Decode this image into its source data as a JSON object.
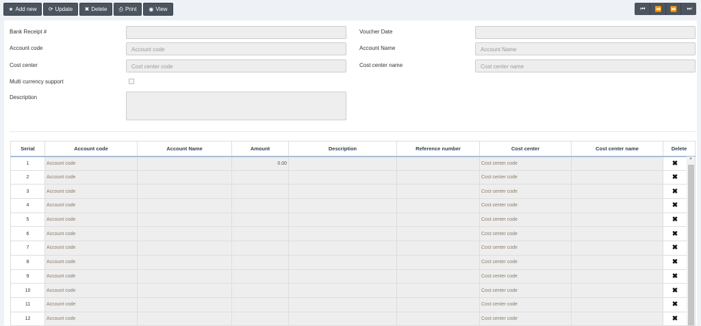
{
  "toolbar": {
    "add_new": "Add new",
    "update": "Update",
    "delete": "Delete",
    "print": "Print",
    "view": "View",
    "nav": [
      "⏮",
      "⏪",
      "⏩",
      "⏭"
    ]
  },
  "form": {
    "bank_receipt_label": "Bank Receipt #",
    "voucher_date_label": "Voucher Date",
    "account_code_label": "Account code",
    "account_code_placeholder": "Account code",
    "account_name_label": "Account Name",
    "account_name_placeholder": "Account Name",
    "cost_center_label": "Cost center",
    "cost_center_placeholder": "Cost center code",
    "cost_center_name_label": "Cost center name",
    "cost_center_name_placeholder": "Cost center name",
    "multi_currency_label": "Multi currency support",
    "description_label": "Description"
  },
  "table": {
    "headers": [
      "Serial",
      "Account code",
      "Account Name",
      "Amount",
      "Description",
      "Reference number",
      "Cost center",
      "Cost center name",
      "Delete"
    ],
    "rows": [
      {
        "serial": "1",
        "account_code": "Account code",
        "amount": "0.00",
        "cost_center": "Cost center code"
      },
      {
        "serial": "2",
        "account_code": "Account code",
        "amount": "",
        "cost_center": "Cost center code"
      },
      {
        "serial": "3",
        "account_code": "Account code",
        "amount": "",
        "cost_center": "Cost center code"
      },
      {
        "serial": "4",
        "account_code": "Account code",
        "amount": "",
        "cost_center": "Cost center code"
      },
      {
        "serial": "5",
        "account_code": "Account code",
        "amount": "",
        "cost_center": "Cost center code"
      },
      {
        "serial": "6",
        "account_code": "Account code",
        "amount": "",
        "cost_center": "Cost center code"
      },
      {
        "serial": "7",
        "account_code": "Account code",
        "amount": "",
        "cost_center": "Cost center code"
      },
      {
        "serial": "8",
        "account_code": "Account code",
        "amount": "",
        "cost_center": "Cost center code"
      },
      {
        "serial": "9",
        "account_code": "Account code",
        "amount": "",
        "cost_center": "Cost center code"
      },
      {
        "serial": "10",
        "account_code": "Account code",
        "amount": "",
        "cost_center": "Cost center code"
      },
      {
        "serial": "11",
        "account_code": "Account code",
        "amount": "",
        "cost_center": "Cost center code"
      },
      {
        "serial": "12",
        "account_code": "Account code",
        "amount": "",
        "cost_center": "Cost center code"
      }
    ],
    "delete_glyph": "✖"
  }
}
